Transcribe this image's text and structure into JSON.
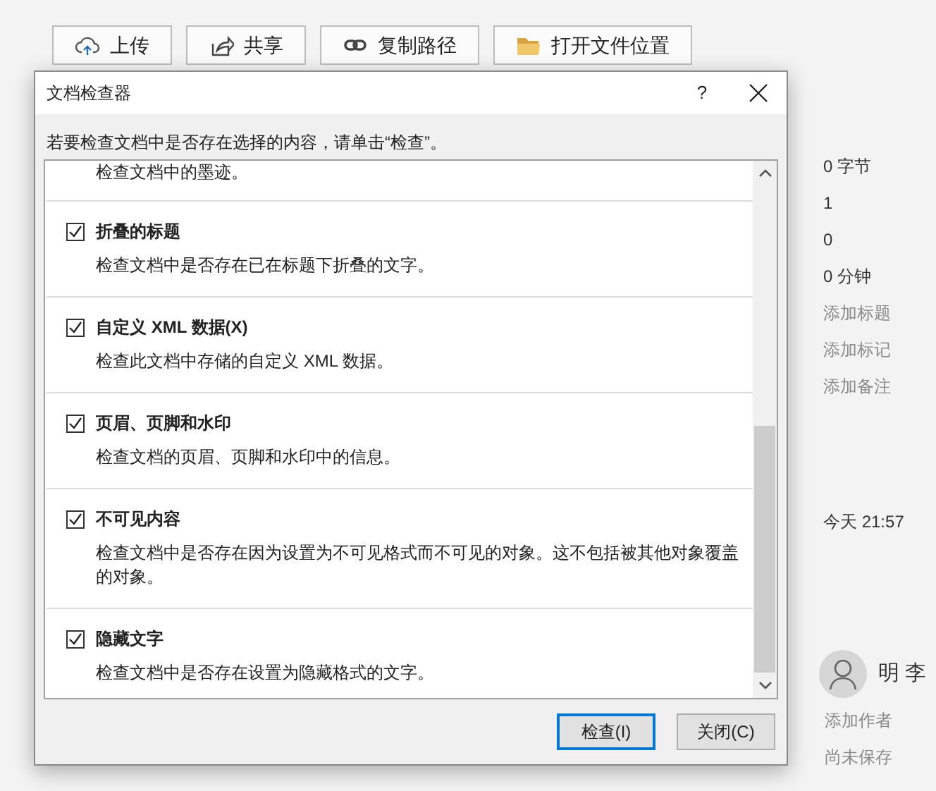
{
  "toolbar": [
    {
      "label": "上传",
      "kind": "upload"
    },
    {
      "label": "共享",
      "kind": "share"
    },
    {
      "label": "复制路径",
      "kind": "link"
    },
    {
      "label": "打开文件位置",
      "kind": "folder"
    }
  ],
  "properties": [
    {
      "text": "0 字节",
      "kind": "value"
    },
    {
      "text": "1",
      "kind": "value"
    },
    {
      "text": "0",
      "kind": "value"
    },
    {
      "text": "0 分钟",
      "kind": "value"
    },
    {
      "text": "添加标题",
      "kind": "hint"
    },
    {
      "text": "添加标记",
      "kind": "hint"
    },
    {
      "text": "添加备注",
      "kind": "hint"
    }
  ],
  "last_modified": "今天 21:57",
  "author": {
    "name": "明 李",
    "add": "添加作者",
    "status": "尚未保存"
  },
  "dialog": {
    "title": "文档检查器",
    "help": "?",
    "instruction": "若要检查文档中是否存在选择的内容，请单击“检查”。",
    "items": [
      {
        "description": "检查文档中的墨迹。"
      },
      {
        "title": "折叠的标题",
        "description": "检查文档中是否存在已在标题下折叠的文字。",
        "checked": true
      },
      {
        "title": "自定义 XML 数据(X)",
        "description": "检查此文档中存储的自定义 XML 数据。",
        "checked": true
      },
      {
        "title": "页眉、页脚和水印",
        "description": "检查文档的页眉、页脚和水印中的信息。",
        "checked": true
      },
      {
        "title": "不可见内容",
        "description": "检查文档中是否存在因为设置为不可见格式而不可见的对象。这不包括被其他对象覆盖的对象。",
        "checked": true
      },
      {
        "title": "隐藏文字",
        "description": "检查文档中是否存在设置为隐藏格式的文字。",
        "checked": true
      }
    ],
    "buttons": [
      {
        "label": "检查(I)",
        "default": true
      },
      {
        "label": "关闭(C)",
        "default": false
      }
    ]
  }
}
